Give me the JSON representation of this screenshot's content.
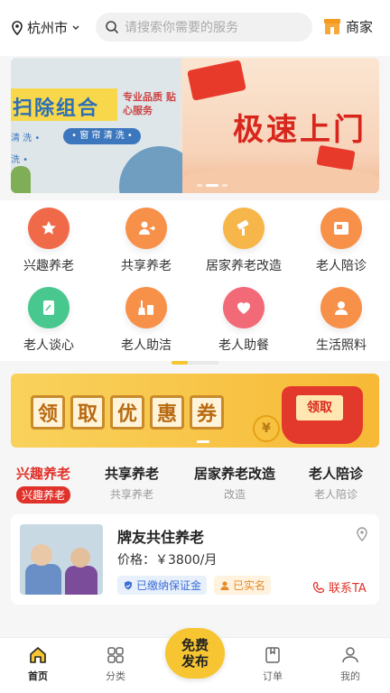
{
  "header": {
    "city": "杭州市",
    "search_placeholder": "请搜索你需要的服务",
    "merchant_label": "商家"
  },
  "banner": {
    "left_title": "扫除组合",
    "left_tag": "专业品质 贴心服务",
    "left_pill": "• 窗 帘 清 洗 •",
    "left_snip1": "清 洗 •",
    "left_snip2": "洗 •",
    "right_title": "极速上门"
  },
  "categories": [
    {
      "label": "兴趣养老",
      "icon": "star-icon",
      "color": "#f06a4a"
    },
    {
      "label": "共享养老",
      "icon": "person-share-icon",
      "color": "#f7914a"
    },
    {
      "label": "居家养老改造",
      "icon": "paint-roller-icon",
      "color": "#f6b64a"
    },
    {
      "label": "老人陪诊",
      "icon": "medical-card-icon",
      "color": "#f7914a"
    },
    {
      "label": "老人谈心",
      "icon": "note-icon",
      "color": "#48c88e"
    },
    {
      "label": "老人助洁",
      "icon": "broom-icon",
      "color": "#f7914a"
    },
    {
      "label": "老人助餐",
      "icon": "heart-icon",
      "color": "#f26a78"
    },
    {
      "label": "生活照料",
      "icon": "caregiver-icon",
      "color": "#f7914a"
    }
  ],
  "coupon": {
    "chars": [
      "领",
      "取",
      "优",
      "惠",
      "券"
    ],
    "bag_label": "领取",
    "coin_label": "¥"
  },
  "tabs": [
    {
      "title": "兴趣养老",
      "sub": "兴趣养老",
      "active": true
    },
    {
      "title": "共享养老",
      "sub": "共享养老",
      "active": false
    },
    {
      "title": "居家养老改造",
      "sub": "改造",
      "active": false
    },
    {
      "title": "老人陪诊",
      "sub": "老人陪诊",
      "active": false
    }
  ],
  "listing": {
    "title": "牌友共住养老",
    "price": "价格：￥3800/月",
    "badge_deposit": "已缴纳保证金",
    "badge_verified": "已实名",
    "contact": "联系TA"
  },
  "nav": {
    "home": "首页",
    "category": "分类",
    "publish_line1": "免费",
    "publish_line2": "发布",
    "orders": "订单",
    "mine": "我的"
  },
  "colors": {
    "accent": "#f7c531",
    "active_red": "#e0322a"
  }
}
